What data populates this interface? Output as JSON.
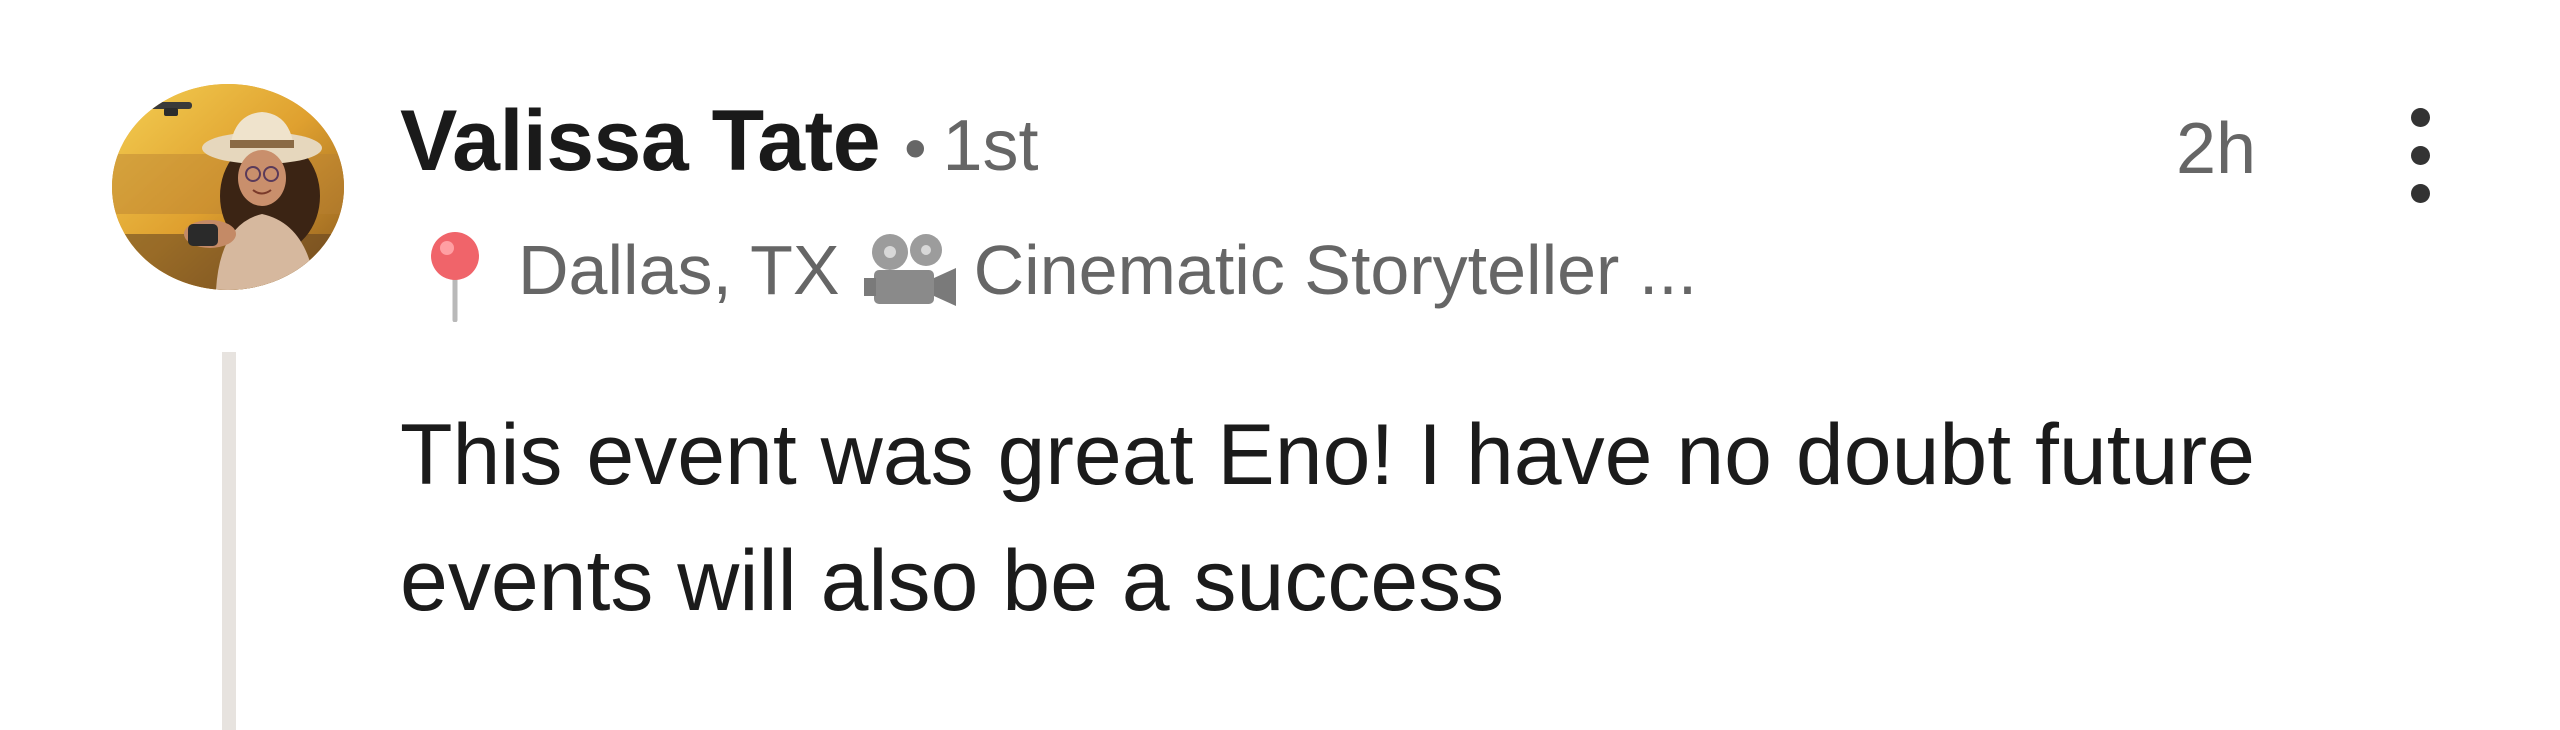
{
  "comment": {
    "author": {
      "name": "Valissa Tate",
      "separator": "•",
      "degree": "1st",
      "avatar_icon": "profile-photo"
    },
    "timestamp": "2h",
    "more_icon": "vertical-ellipsis-icon",
    "headline": {
      "location_icon": "round-pushpin-emoji",
      "location": "Dallas, TX",
      "camera_icon": "movie-camera-emoji",
      "title": "Cinematic Storyteller ..."
    },
    "text": "This event was great Eno! I have no doubt future events will also be a success",
    "colors": {
      "name": "#1a1a1a",
      "secondary": "#666666",
      "thread_line": "#e7e3df"
    }
  }
}
